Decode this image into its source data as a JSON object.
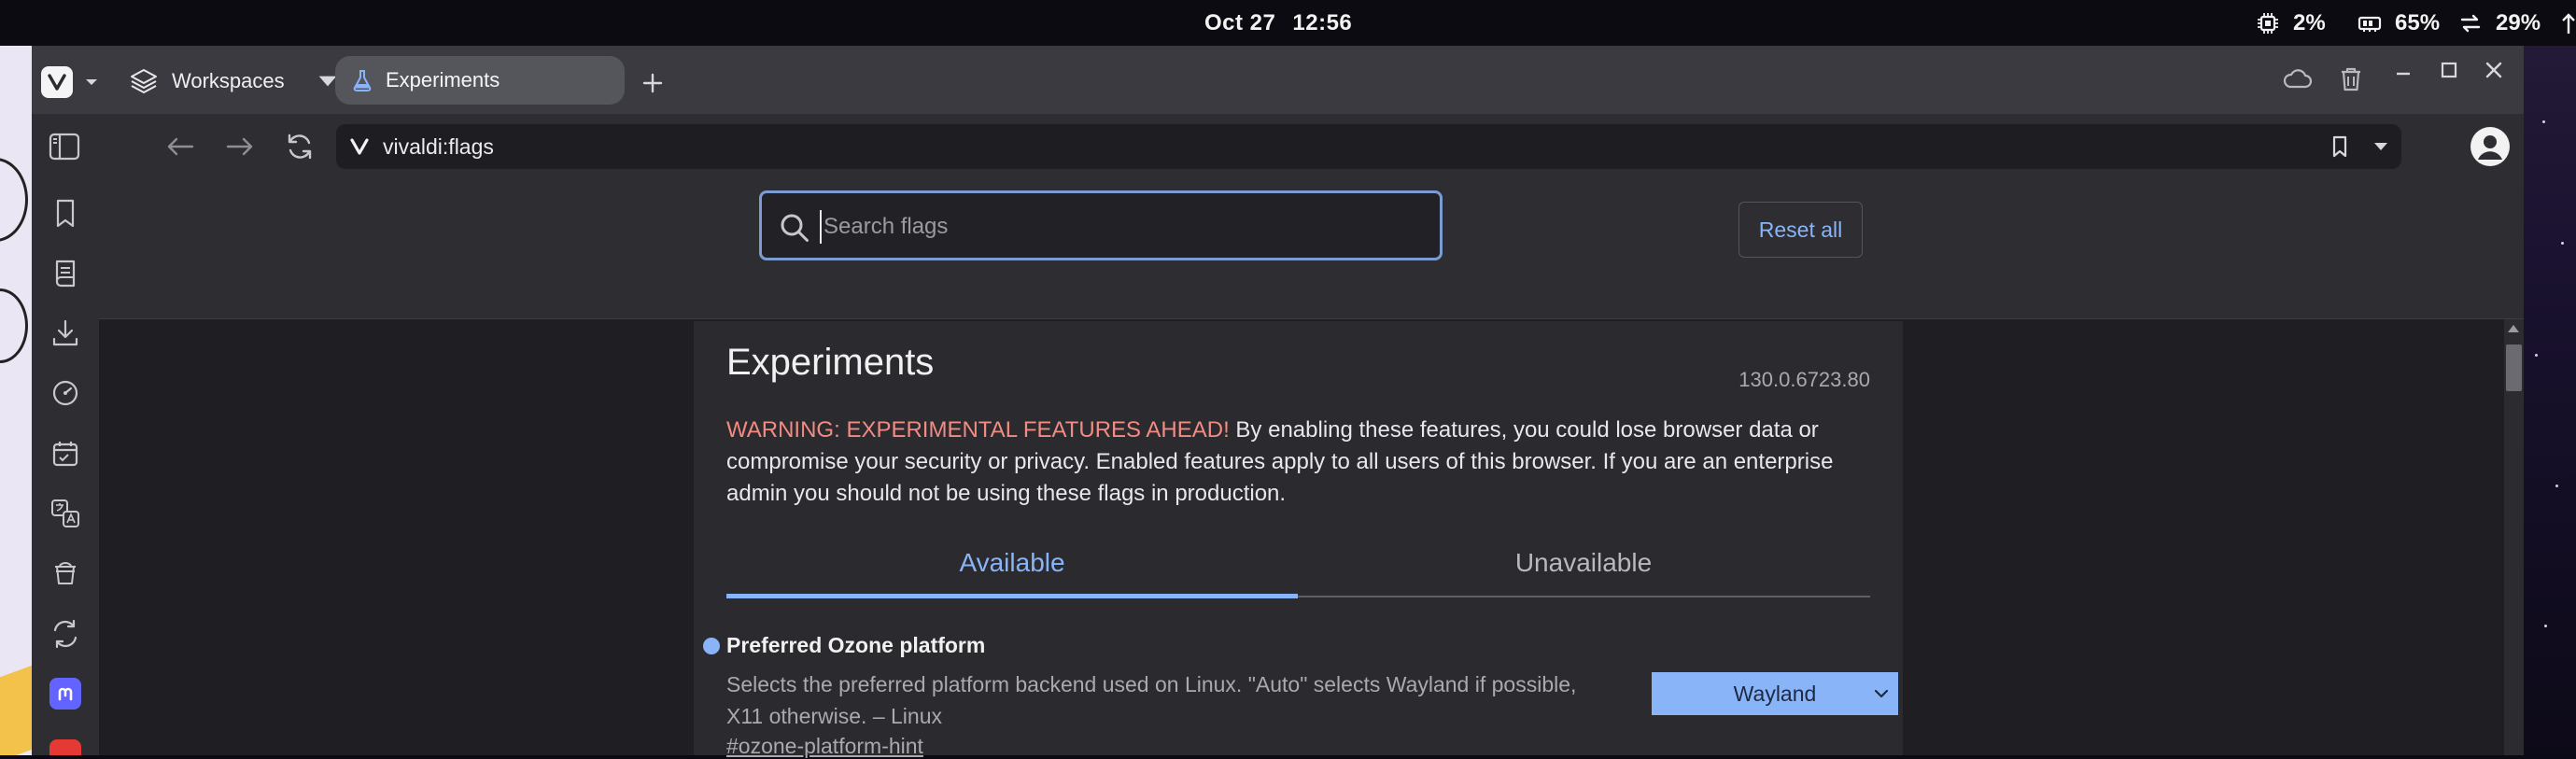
{
  "system_bar": {
    "date": "Oct 27",
    "time": "12:56",
    "cpu": "2%",
    "memory": "65%",
    "network": "29%"
  },
  "browser": {
    "workspaces_label": "Workspaces",
    "active_tab_label": "Experiments",
    "url": "vivaldi:flags"
  },
  "flags_page": {
    "search_placeholder": "Search flags",
    "reset_all_label": "Reset all",
    "title": "Experiments",
    "version": "130.0.6723.80",
    "warning_prefix": "WARNING: EXPERIMENTAL FEATURES AHEAD!",
    "warning_text": " By enabling these features, you could lose browser data or compromise your security or privacy. Enabled features apply to all users of this browser. If you are an enterprise admin you should not be using these flags in production.",
    "tabs": [
      {
        "label": "Available"
      },
      {
        "label": "Unavailable"
      }
    ],
    "flags": [
      {
        "name": "Preferred Ozone platform",
        "description": "Selects the preferred platform backend used on Linux. \"Auto\" selects Wayland if possible, X11 otherwise. – Linux",
        "link": "#ozone-platform-hint",
        "selected_value": "Wayland"
      }
    ]
  },
  "colors": {
    "accent": "#8ab4f8",
    "warning": "#f28b82",
    "background": "#1f1f23",
    "card": "#2a2a2f"
  }
}
